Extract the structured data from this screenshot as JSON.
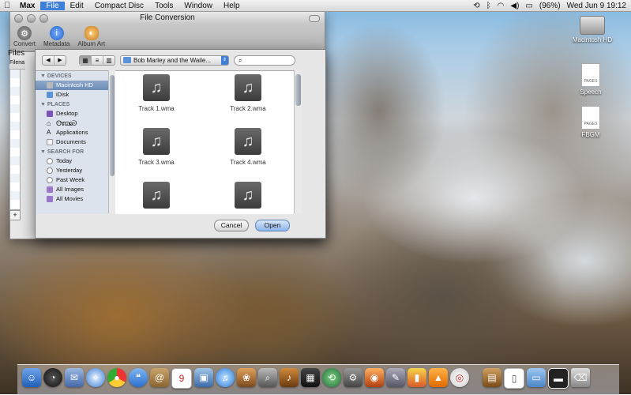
{
  "menubar": {
    "app_name": "Max",
    "items": [
      "File",
      "Edit",
      "Compact Disc",
      "Tools",
      "Window",
      "Help"
    ],
    "battery": "(96%)",
    "clock": "Wed Jun 9  19:12"
  },
  "max_window": {
    "title": "File Conversion",
    "toolbar": [
      {
        "label": "Convert",
        "icon": "gear-icon"
      },
      {
        "label": "Metadata",
        "icon": "info-icon"
      },
      {
        "label": "Album Art",
        "icon": "palette-icon"
      }
    ],
    "files_label": "Files",
    "files_column": "Filena",
    "add_button": "+"
  },
  "sheet": {
    "back": "◀",
    "forward": "▶",
    "path_folder": "Bob Marley and the Waile...",
    "search_placeholder": "",
    "sidebar": {
      "devices_header": "DEVICES",
      "devices": [
        "Macintosh HD",
        "iDisk"
      ],
      "places_header": "PLACES",
      "places": [
        "Desktop",
        "Applications",
        "Documents"
      ],
      "search_header": "SEARCH FOR",
      "searches": [
        "Today",
        "Yesterday",
        "Past Week",
        "All Images",
        "All Movies"
      ]
    },
    "files": [
      "Track 1.wma",
      "Track 2.wma",
      "Track 3.wma",
      "Track 4.wma",
      "",
      ""
    ],
    "cancel_label": "Cancel",
    "open_label": "Open"
  },
  "desktop_icons": [
    {
      "label": "Macintosh HD",
      "icon": "hard-drive-icon"
    },
    {
      "label": "Speech",
      "icon": "pages-doc-icon",
      "badge": "PAGES"
    },
    {
      "label": "FBGM",
      "icon": "pages-doc-icon",
      "badge": "PAGES"
    }
  ],
  "colors": {
    "selection_blue": "#3d7fd9",
    "sidebar_bg": "#dce3ec"
  }
}
